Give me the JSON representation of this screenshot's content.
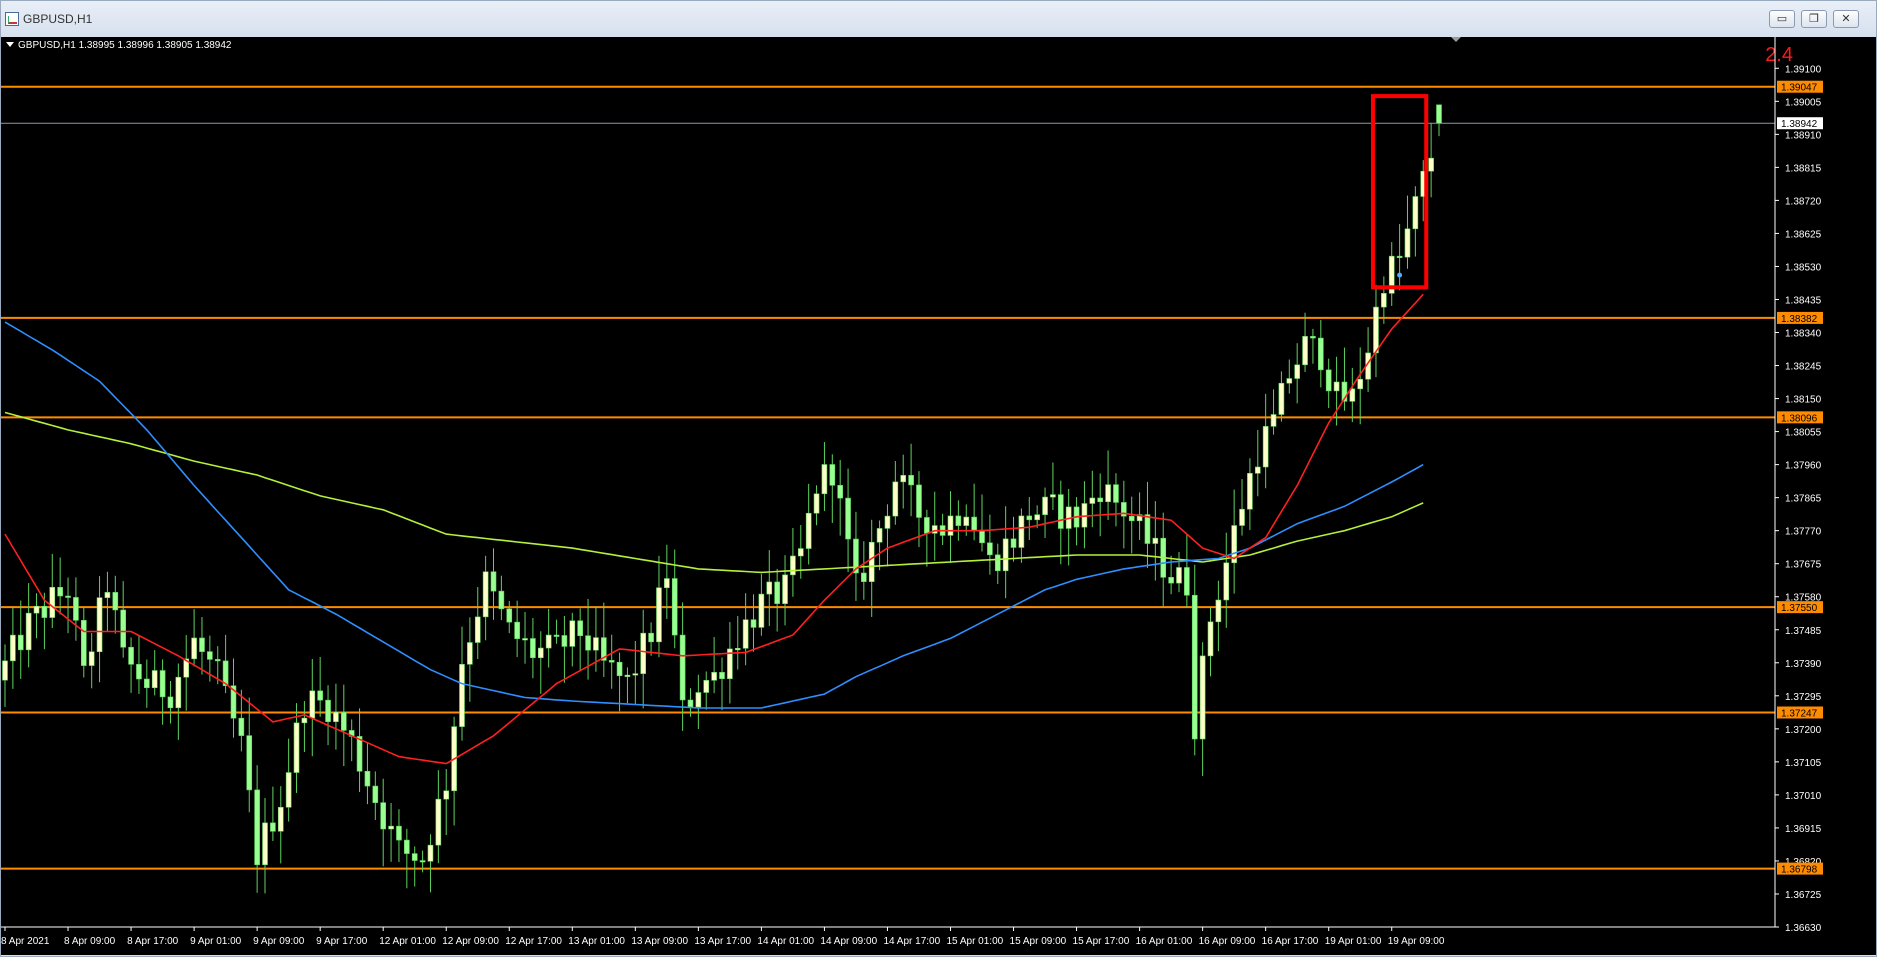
{
  "window": {
    "title": "GBPUSD,H1",
    "minimize_glyph": "▭",
    "restore_glyph": "❐",
    "close_glyph": "✕"
  },
  "chart_data": {
    "type": "candlestick",
    "symbol": "GBPUSD",
    "timeframe": "H1",
    "ohlc_header": "GBPUSD,H1  1.38995 1.38996 1.38905 1.38942",
    "open": 1.38995,
    "high": 1.38996,
    "low": 1.38905,
    "close": 1.38942,
    "ylim": [
      1.3663,
      1.3919
    ],
    "y_ticks": [
      "1.39100",
      "1.39005",
      "1.38910",
      "1.38815",
      "1.38720",
      "1.38625",
      "1.38530",
      "1.38435",
      "1.38340",
      "1.38245",
      "1.38150",
      "1.38055",
      "1.37960",
      "1.37865",
      "1.37770",
      "1.37675",
      "1.37580",
      "1.37485",
      "1.37390",
      "1.37295",
      "1.37200",
      "1.37105",
      "1.37010",
      "1.36915",
      "1.36820",
      "1.36725",
      "1.36630"
    ],
    "x_labels": [
      "8 Apr 2021",
      "8 Apr 09:00",
      "8 Apr 17:00",
      "9 Apr 01:00",
      "9 Apr 09:00",
      "9 Apr 17:00",
      "12 Apr 01:00",
      "12 Apr 09:00",
      "12 Apr 17:00",
      "13 Apr 01:00",
      "13 Apr 09:00",
      "13 Apr 17:00",
      "14 Apr 01:00",
      "14 Apr 09:00",
      "14 Apr 17:00",
      "15 Apr 01:00",
      "15 Apr 09:00",
      "15 Apr 17:00",
      "16 Apr 01:00",
      "16 Apr 09:00",
      "16 Apr 17:00",
      "19 Apr 01:00",
      "19 Apr 09:00"
    ],
    "x_label_bar_index": [
      0,
      8,
      16,
      24,
      32,
      40,
      48,
      56,
      64,
      72,
      80,
      88,
      96,
      104,
      112,
      120,
      128,
      136,
      144,
      152,
      160,
      168,
      176
    ],
    "levels": [
      {
        "value": 1.39047,
        "label": "1.39047"
      },
      {
        "value": 1.38382,
        "label": "1.38382"
      },
      {
        "value": 1.38096,
        "label": "1.38096"
      },
      {
        "value": 1.3755,
        "label": "1.37550"
      },
      {
        "value": 1.37247,
        "label": "1.37247"
      },
      {
        "value": 1.36798,
        "label": "1.36798"
      }
    ],
    "current_price": {
      "value": 1.38942,
      "label": "1.38942"
    },
    "annotation": {
      "text": "2.4",
      "color": "#ff1a1a"
    },
    "highlight_box": {
      "start_bar": 174,
      "end_bar": 180,
      "low": 1.3847,
      "high": 1.3902,
      "color": "#ff0000"
    },
    "colors": {
      "background": "#000000",
      "bull": "#ffffc8",
      "bear": "#98ff90",
      "wick": "#5fd35f",
      "level": "#ff8c00",
      "ma_fast": "#ff2020",
      "ma_mid": "#2f8fff",
      "ma_slow": "#b4f03c",
      "axis_text": "#ffffff",
      "box": "#ff0000"
    },
    "series_meta": [
      {
        "color": "#ff2020"
      },
      {
        "color": "#2f8fff"
      },
      {
        "color": "#b4f03c"
      }
    ],
    "close_anchors": [
      [
        0,
        1.3738
      ],
      [
        3,
        1.375
      ],
      [
        6,
        1.3757
      ],
      [
        8,
        1.376
      ],
      [
        10,
        1.3735
      ],
      [
        13,
        1.3762
      ],
      [
        15,
        1.374
      ],
      [
        18,
        1.3733
      ],
      [
        21,
        1.3731
      ],
      [
        24,
        1.3745
      ],
      [
        27,
        1.3735
      ],
      [
        30,
        1.3715
      ],
      [
        32,
        1.3684
      ],
      [
        35,
        1.37
      ],
      [
        38,
        1.3728
      ],
      [
        41,
        1.3727
      ],
      [
        44,
        1.3716
      ],
      [
        47,
        1.37
      ],
      [
        50,
        1.3685
      ],
      [
        53,
        1.3683
      ],
      [
        56,
        1.3705
      ],
      [
        58,
        1.374
      ],
      [
        61,
        1.3762
      ],
      [
        64,
        1.3748
      ],
      [
        67,
        1.3742
      ],
      [
        70,
        1.3743
      ],
      [
        73,
        1.3748
      ],
      [
        76,
        1.3738
      ],
      [
        79,
        1.3733
      ],
      [
        82,
        1.3748
      ],
      [
        84,
        1.3765
      ],
      [
        86,
        1.3725
      ],
      [
        88,
        1.3733
      ],
      [
        90,
        1.3735
      ],
      [
        93,
        1.3747
      ],
      [
        96,
        1.3756
      ],
      [
        99,
        1.376
      ],
      [
        101,
        1.377
      ],
      [
        103,
        1.379
      ],
      [
        105,
        1.3795
      ],
      [
        108,
        1.376
      ],
      [
        111,
        1.3778
      ],
      [
        113,
        1.3792
      ],
      [
        116,
        1.3782
      ],
      [
        119,
        1.3778
      ],
      [
        122,
        1.3785
      ],
      [
        125,
        1.3768
      ],
      [
        128,
        1.3775
      ],
      [
        130,
        1.3782
      ],
      [
        133,
        1.3783
      ],
      [
        136,
        1.378
      ],
      [
        139,
        1.379
      ],
      [
        142,
        1.3783
      ],
      [
        145,
        1.3774
      ],
      [
        148,
        1.3764
      ],
      [
        150,
        1.3762
      ],
      [
        151,
        1.3722
      ],
      [
        153,
        1.3752
      ],
      [
        155,
        1.3768
      ],
      [
        157,
        1.3785
      ],
      [
        159,
        1.38
      ],
      [
        161,
        1.3808
      ],
      [
        163,
        1.3822
      ],
      [
        165,
        1.383
      ],
      [
        167,
        1.3828
      ],
      [
        169,
        1.3815
      ],
      [
        171,
        1.3815
      ],
      [
        173,
        1.383
      ],
      [
        175,
        1.385
      ],
      [
        177,
        1.3855
      ],
      [
        179,
        1.387
      ],
      [
        181,
        1.3885
      ],
      [
        182,
        1.3894
      ]
    ],
    "ma_fast_anchors": [
      [
        0,
        1.3776
      ],
      [
        5,
        1.3757
      ],
      [
        10,
        1.3748
      ],
      [
        16,
        1.3748
      ],
      [
        22,
        1.3741
      ],
      [
        28,
        1.3733
      ],
      [
        34,
        1.3722
      ],
      [
        38,
        1.3724
      ],
      [
        42,
        1.372
      ],
      [
        46,
        1.3716
      ],
      [
        50,
        1.3712
      ],
      [
        56,
        1.371
      ],
      [
        62,
        1.3718
      ],
      [
        70,
        1.3733
      ],
      [
        78,
        1.3743
      ],
      [
        86,
        1.3741
      ],
      [
        94,
        1.3742
      ],
      [
        100,
        1.3747
      ],
      [
        104,
        1.3757
      ],
      [
        108,
        1.3766
      ],
      [
        112,
        1.3772
      ],
      [
        118,
        1.3777
      ],
      [
        124,
        1.3777
      ],
      [
        130,
        1.3778
      ],
      [
        136,
        1.3781
      ],
      [
        142,
        1.3782
      ],
      [
        148,
        1.378
      ],
      [
        152,
        1.3772
      ],
      [
        156,
        1.3769
      ],
      [
        160,
        1.3775
      ],
      [
        164,
        1.379
      ],
      [
        168,
        1.3808
      ],
      [
        172,
        1.3822
      ],
      [
        176,
        1.3835
      ],
      [
        180,
        1.3845
      ]
    ],
    "ma_mid_anchors": [
      [
        0,
        1.3837
      ],
      [
        6,
        1.3829
      ],
      [
        12,
        1.382
      ],
      [
        18,
        1.3806
      ],
      [
        24,
        1.379
      ],
      [
        30,
        1.3775
      ],
      [
        36,
        1.376
      ],
      [
        42,
        1.3753
      ],
      [
        48,
        1.3745
      ],
      [
        54,
        1.3737
      ],
      [
        58,
        1.3733
      ],
      [
        62,
        1.3731
      ],
      [
        66,
        1.3729
      ],
      [
        72,
        1.3728
      ],
      [
        80,
        1.3727
      ],
      [
        88,
        1.3726
      ],
      [
        96,
        1.3726
      ],
      [
        104,
        1.373
      ],
      [
        108,
        1.3735
      ],
      [
        114,
        1.3741
      ],
      [
        120,
        1.3746
      ],
      [
        126,
        1.3753
      ],
      [
        132,
        1.376
      ],
      [
        136,
        1.3763
      ],
      [
        142,
        1.3766
      ],
      [
        148,
        1.3768
      ],
      [
        154,
        1.3769
      ],
      [
        158,
        1.3772
      ],
      [
        164,
        1.3779
      ],
      [
        170,
        1.3784
      ],
      [
        176,
        1.3791
      ],
      [
        180,
        1.3796
      ]
    ],
    "ma_slow_anchors": [
      [
        0,
        1.3811
      ],
      [
        8,
        1.3806
      ],
      [
        16,
        1.3802
      ],
      [
        24,
        1.3797
      ],
      [
        32,
        1.3793
      ],
      [
        40,
        1.3787
      ],
      [
        48,
        1.3783
      ],
      [
        56,
        1.3776
      ],
      [
        64,
        1.3774
      ],
      [
        72,
        1.3772
      ],
      [
        80,
        1.3769
      ],
      [
        88,
        1.3766
      ],
      [
        96,
        1.3765
      ],
      [
        104,
        1.3766
      ],
      [
        112,
        1.3767
      ],
      [
        120,
        1.3768
      ],
      [
        128,
        1.3769
      ],
      [
        136,
        1.377
      ],
      [
        144,
        1.377
      ],
      [
        152,
        1.3768
      ],
      [
        158,
        1.377
      ],
      [
        164,
        1.3774
      ],
      [
        170,
        1.3777
      ],
      [
        176,
        1.3781
      ],
      [
        180,
        1.3785
      ]
    ]
  }
}
